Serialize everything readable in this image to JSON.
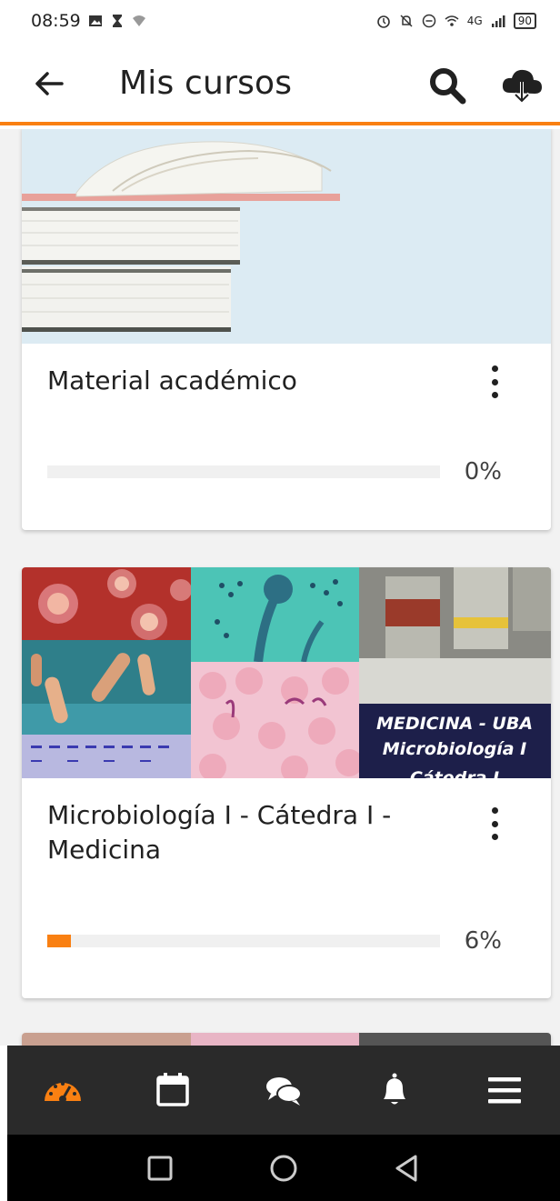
{
  "status_bar": {
    "time": "08:59",
    "network": "4G",
    "battery": "90"
  },
  "app_bar": {
    "title": "Mis cursos"
  },
  "courses": [
    {
      "title": "Material académico",
      "progress": 0,
      "progress_label": "0%"
    },
    {
      "title": "Microbiología I - Cátedra I - Medicina",
      "image_caption_line1": "MEDICINA - UBA",
      "image_caption_line2": "Microbiología I",
      "image_caption_line3": "Cátedra I",
      "progress": 6,
      "progress_label": "6%"
    }
  ],
  "tabs": [
    {
      "icon": "dashboard-icon",
      "active": true
    },
    {
      "icon": "calendar-icon",
      "active": false
    },
    {
      "icon": "messages-icon",
      "active": false
    },
    {
      "icon": "bell-icon",
      "active": false
    },
    {
      "icon": "menu-icon",
      "active": false
    }
  ],
  "colors": {
    "accent": "#f98012",
    "tabbar": "#2a2a2a",
    "active_tab": "#f98012"
  }
}
